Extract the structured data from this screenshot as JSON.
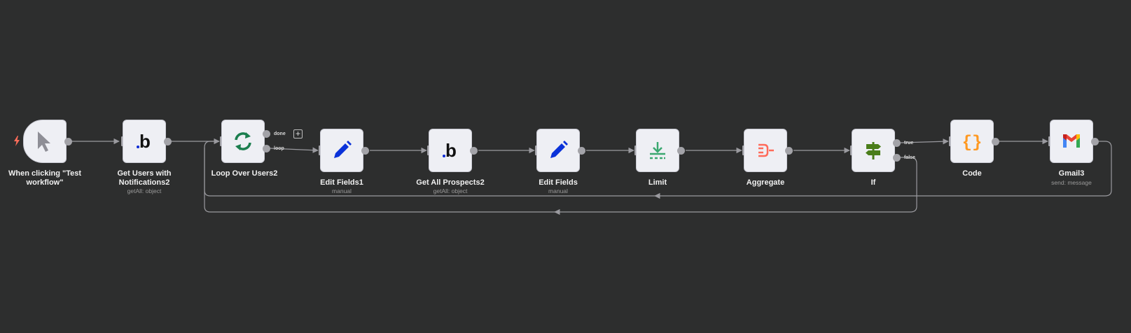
{
  "workflow": {
    "nodes": [
      {
        "id": "trigger",
        "label": "When clicking \"Test workflow\"",
        "subtitle": "",
        "icon": "cursor-icon"
      },
      {
        "id": "getusers",
        "label": "Get Users with Notifications2",
        "subtitle": "getAll: object",
        "icon": "bubble-b-icon"
      },
      {
        "id": "loop",
        "label": "Loop Over Users2",
        "subtitle": "",
        "icon": "loop-arrows-icon"
      },
      {
        "id": "edit1",
        "label": "Edit Fields1",
        "subtitle": "manual",
        "icon": "pencil-icon"
      },
      {
        "id": "prospects",
        "label": "Get All Prospects2",
        "subtitle": "getAll: object",
        "icon": "bubble-b-icon"
      },
      {
        "id": "edit",
        "label": "Edit Fields",
        "subtitle": "manual",
        "icon": "pencil-icon"
      },
      {
        "id": "limit",
        "label": "Limit",
        "subtitle": "",
        "icon": "limit-icon"
      },
      {
        "id": "aggregate",
        "label": "Aggregate",
        "subtitle": "",
        "icon": "aggregate-icon"
      },
      {
        "id": "if",
        "label": "If",
        "subtitle": "",
        "icon": "signpost-icon"
      },
      {
        "id": "code",
        "label": "Code",
        "subtitle": "",
        "icon": "braces-icon"
      },
      {
        "id": "gmail",
        "label": "Gmail3",
        "subtitle": "send: message",
        "icon": "gmail-icon"
      }
    ],
    "ports": {
      "loop_done": "done",
      "loop_loop": "loop",
      "if_true": "true",
      "if_false": "false"
    },
    "add_button": "+"
  },
  "colors": {
    "canvas": "#2d2e2e",
    "wire": "#9a9a9f",
    "node_bg": "#eeeff4",
    "trigger_bolt": "#ff6d5a",
    "bubble_dot": "#0d2ad4",
    "loop_green": "#1b7e4e",
    "pencil_blue": "#0a32d9",
    "limit_green": "#3aa870",
    "aggregate_red": "#ff6b5a",
    "if_green": "#4a7d1a",
    "code_orange": "#ff9922"
  }
}
